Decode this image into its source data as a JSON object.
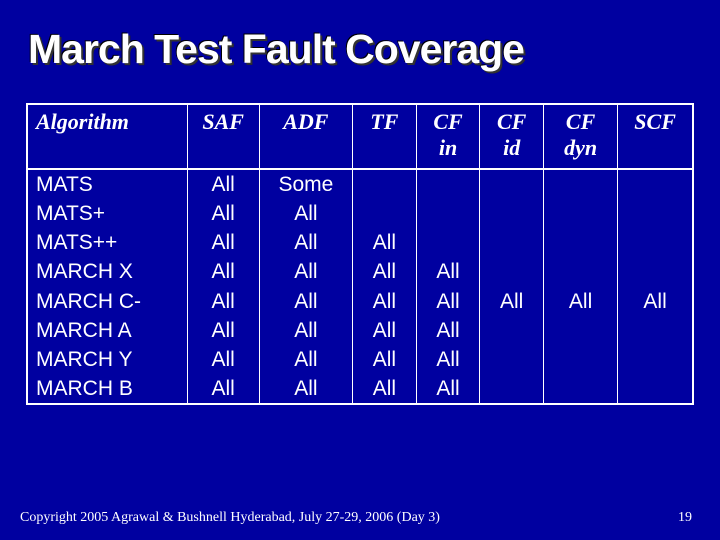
{
  "title": "March Test Fault Coverage",
  "columns": [
    {
      "line1": "Algorithm",
      "line2": ""
    },
    {
      "line1": "SAF",
      "line2": ""
    },
    {
      "line1": "ADF",
      "line2": ""
    },
    {
      "line1": "TF",
      "line2": ""
    },
    {
      "line1": "CF",
      "line2": "in"
    },
    {
      "line1": "CF",
      "line2": "id"
    },
    {
      "line1": "CF",
      "line2": "dyn"
    },
    {
      "line1": "SCF",
      "line2": ""
    }
  ],
  "rows": [
    {
      "alg": "MATS",
      "c": [
        "All",
        "Some",
        "",
        "",
        "",
        "",
        ""
      ]
    },
    {
      "alg": "MATS+",
      "c": [
        "All",
        "All",
        "",
        "",
        "",
        "",
        ""
      ]
    },
    {
      "alg": "MATS++",
      "c": [
        "All",
        "All",
        "All",
        "",
        "",
        "",
        ""
      ]
    },
    {
      "alg": "MARCH X",
      "c": [
        "All",
        "All",
        "All",
        "All",
        "",
        "",
        ""
      ]
    },
    {
      "alg": "MARCH C-",
      "c": [
        "All",
        "All",
        "All",
        "All",
        "All",
        "All",
        "All"
      ]
    },
    {
      "alg": "MARCH A",
      "c": [
        "All",
        "All",
        "All",
        "All",
        "",
        "",
        ""
      ]
    },
    {
      "alg": "MARCH Y",
      "c": [
        "All",
        "All",
        "All",
        "All",
        "",
        "",
        ""
      ]
    },
    {
      "alg": "MARCH B",
      "c": [
        "All",
        "All",
        "All",
        "All",
        "",
        "",
        ""
      ]
    }
  ],
  "footer": {
    "copyright": "Copyright 2005 Agrawal & Bushnell   Hyderabad, July 27-29, 2006 (Day 3)",
    "page": "19"
  }
}
